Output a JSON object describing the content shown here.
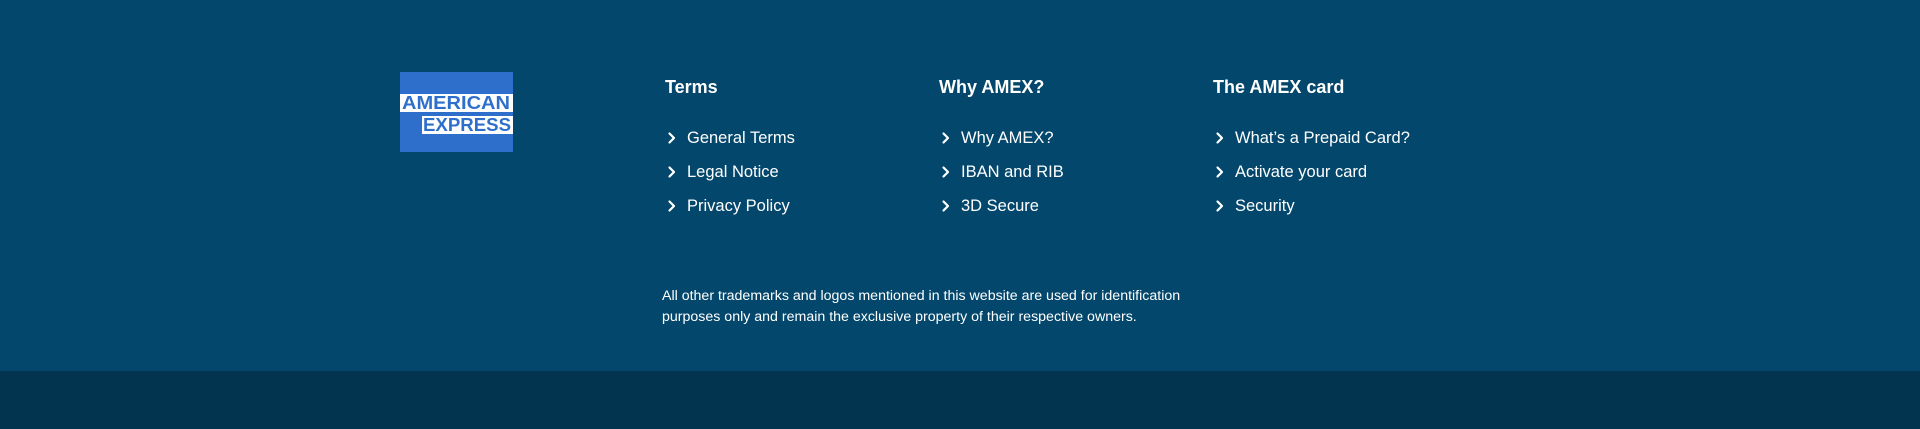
{
  "logo": {
    "line1": "AMERICAN",
    "line2": "EXPRESS",
    "color": "#2e6fcb"
  },
  "columns": [
    {
      "title": "Terms",
      "links": [
        {
          "label": "General Terms"
        },
        {
          "label": "Legal Notice"
        },
        {
          "label": "Privacy Policy"
        }
      ]
    },
    {
      "title": "Why AMEX?",
      "links": [
        {
          "label": "Why AMEX?"
        },
        {
          "label": "IBAN and RIB"
        },
        {
          "label": "3D Secure"
        }
      ]
    },
    {
      "title": "The AMEX card",
      "links": [
        {
          "label": "What’s a Prepaid Card?"
        },
        {
          "label": "Activate your card"
        },
        {
          "label": "Security"
        }
      ]
    }
  ],
  "disclaimer": "All other trademarks and logos mentioned in this website are used for identification purposes only and remain the exclusive property of their respective owners.",
  "colors": {
    "footer_background": "#04476c",
    "bottom_bar": "#03344f",
    "text": "#ffffff"
  },
  "icons": {
    "link_bullet": "chevron-right-icon"
  }
}
